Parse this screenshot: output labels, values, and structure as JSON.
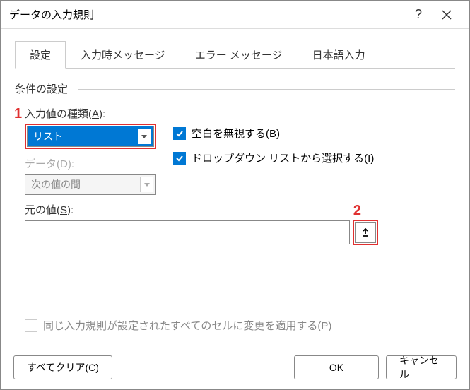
{
  "dialog": {
    "title": "データの入力規則"
  },
  "tabs": {
    "settings": "設定",
    "input_message": "入力時メッセージ",
    "error_message": "エラー メッセージ",
    "ime": "日本語入力"
  },
  "fieldset": {
    "label": "条件の設定"
  },
  "allow": {
    "label_prefix": "入力値の種類(",
    "label_key": "A",
    "label_suffix": "):",
    "value": "リスト"
  },
  "data_field": {
    "label_prefix": "データ(",
    "label_key": "D",
    "label_suffix": "):",
    "value": "次の値の間"
  },
  "ignore_blank": {
    "label_prefix": "空白を無視する(",
    "label_key": "B",
    "label_suffix": ")"
  },
  "dropdown": {
    "label_prefix": "ドロップダウン リストから選択する(",
    "label_key": "I",
    "label_suffix": ")"
  },
  "source": {
    "label_prefix": "元の値(",
    "label_key": "S",
    "label_suffix": "):",
    "value": ""
  },
  "apply_all": {
    "label_prefix": "同じ入力規則が設定されたすべてのセルに変更を適用する(",
    "label_key": "P",
    "label_suffix": ")"
  },
  "buttons": {
    "clear_prefix": "すべてクリア(",
    "clear_key": "C",
    "clear_suffix": ")",
    "ok": "OK",
    "cancel": "キャンセル"
  },
  "annotations": {
    "one": "1",
    "two": "2"
  }
}
